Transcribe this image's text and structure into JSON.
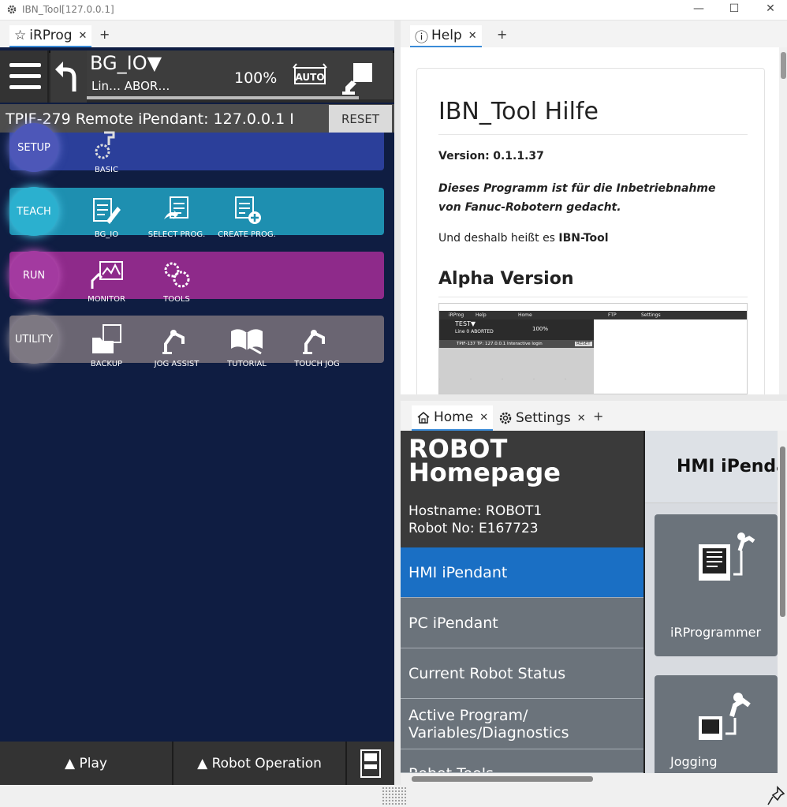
{
  "window": {
    "title": "IBN_Tool[127.0.0.1]",
    "minimize": "—",
    "maximize": "☐",
    "close": "✕"
  },
  "left_tab": {
    "star": "☆",
    "label": "iRProg",
    "close": "✕",
    "add": "+"
  },
  "help_tab": {
    "icon": "ⓘ",
    "label": "Help",
    "close": "✕",
    "add": "+"
  },
  "home_tabs": [
    {
      "label": "Home",
      "close": "✕"
    },
    {
      "label": "Settings",
      "close": "✕"
    }
  ],
  "home_add": "+",
  "pendant": {
    "program": "BG_IO",
    "program_arrow": "▼",
    "line_status": "Lin…  ABOR…",
    "override": "100%",
    "mode": "AUTO",
    "status_line": "TPIF-279   Remote iPendant: 127.0.0.1 I",
    "reset": "RESET",
    "rows": [
      {
        "name": "SETUP",
        "items": [
          "BASIC"
        ]
      },
      {
        "name": "TEACH",
        "items": [
          "BG_IO",
          "SELECT PROG.",
          "CREATE PROG."
        ]
      },
      {
        "name": "RUN",
        "items": [
          "MONITOR",
          "TOOLS"
        ]
      },
      {
        "name": "UTILITY",
        "items": [
          "BACKUP",
          "JOG ASSIST",
          "TUTORIAL",
          "TOUCH JOG"
        ]
      }
    ],
    "bottom": {
      "play": "▲ Play",
      "robot_op": "▲ Robot Operation"
    }
  },
  "help": {
    "title": "IBN_Tool Hilfe",
    "version_label": "Version:",
    "version": "0.1.1.37",
    "intro": "Dieses Programm ist für die Inbetriebnahme von Fanuc-Robotern gedacht.",
    "line2_pre": "Und deshalb heißt es ",
    "line2_bold": "IBN-Tool",
    "alpha": "Alpha Version",
    "preview": {
      "tabs": [
        "iRProg",
        "Help",
        "Home",
        "FTP",
        "Settings"
      ],
      "prog": "TEST▼",
      "line": "Line 0 ABORTED",
      "override": "100%",
      "status": "TPIF-137  TP: 127.0.0.1 Interactive login",
      "reset": "RESET"
    }
  },
  "home": {
    "title_line1": "ROBOT",
    "title_line2": "Homepage",
    "hostname": "Hostname: ROBOT1",
    "robot_no": "Robot No: E167723",
    "nav": [
      "HMI iPendant",
      "PC iPendant",
      "Current Robot Status",
      "Active Program/ Variables/Diagnostics",
      "Robot Tools"
    ],
    "active_nav": 0,
    "right_title": "HMI iPendant",
    "tiles": [
      "iRProgrammer",
      "Jogging"
    ]
  },
  "colors": {
    "accent": "#1a6fc4",
    "setup": "#2b3f9a",
    "teach": "#1e8fb0",
    "run": "#8e2a8a",
    "utility": "#6a6572"
  }
}
